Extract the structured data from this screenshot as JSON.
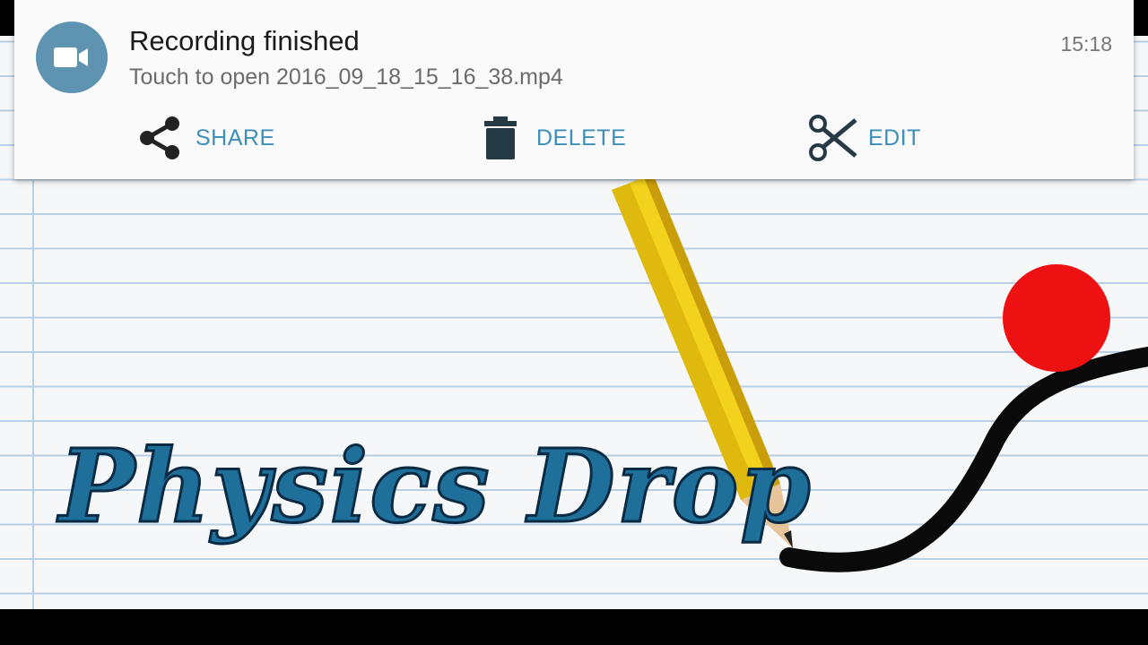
{
  "notification": {
    "title": "Recording finished",
    "text": "Touch to open 2016_09_18_15_16_38.mp4",
    "time": "15:18",
    "app_icon": "video-camera-icon",
    "accent_color": "#3d8fb8",
    "actions": [
      {
        "label": "SHARE",
        "icon": "share-icon"
      },
      {
        "label": "DELETE",
        "icon": "trash-icon"
      },
      {
        "label": "EDIT",
        "icon": "scissors-icon"
      }
    ]
  },
  "game": {
    "title": "Physics Drop",
    "ball_color": "#ee1111",
    "pencil_color": "#f2d21c"
  }
}
